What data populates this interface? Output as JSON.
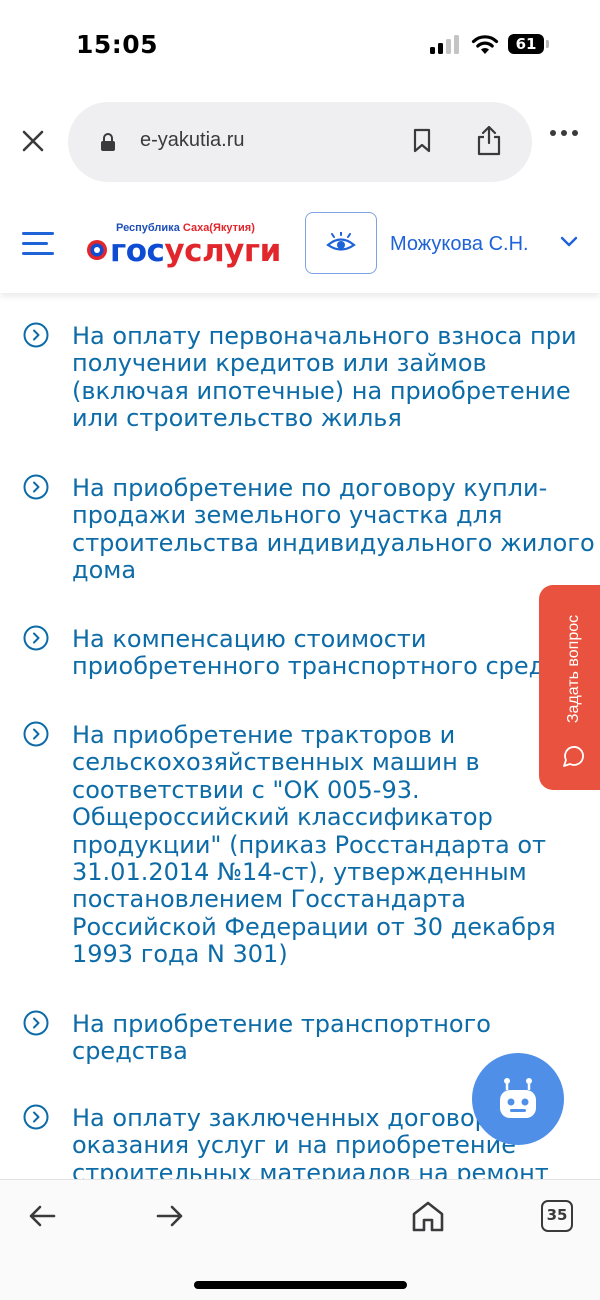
{
  "status_bar": {
    "time": "15:05",
    "battery": "61"
  },
  "browser": {
    "url": "e-yakutia.ru",
    "icons": [
      "close-icon",
      "lock-icon",
      "bookmark-icon",
      "share-icon",
      "more-icon"
    ]
  },
  "header": {
    "logo_region_prefix": "Республика ",
    "logo_region_suffix": "Саха(Якутия)",
    "logo_word_1": "гос",
    "logo_word_2": "услуги",
    "user_name": "Можукова С.Н.",
    "brand_blue": "#0d4cd3",
    "brand_red": "#e1262c"
  },
  "items": [
    {
      "text": "На оплату первоначального взноса при\nполучении кредитов или займов\n(включая ипотечные) на приобретение\nили строительство жилья"
    },
    {
      "text": "На приобретение по договору купли-\nпродажи земельного участка для\nстроительства индивидуального жилого\nдома"
    },
    {
      "text": "На компенсацию стоимости\nприобретенного транспортного средства"
    },
    {
      "text": "На приобретение тракторов и\nсельскохозяйственных машин в\nсоответствии с \"ОК 005-93.\nОбщероссийский классификатор\nпродукции\" (приказ Росстандарта от\n31.01.2014 №14-ст), утвержденным\nпостановлением Госстандарта\nРоссийской Федерации от 30 декабря\n1993 года N 301)"
    },
    {
      "text": "На приобретение транспортного\nсредства"
    },
    {
      "text": "На оплату заключенных договоров\nоказания услуг и на приобретение\nстроительных материалов на ремонт"
    }
  ],
  "side_tab": {
    "label": "Задать вопрос",
    "color": "#e9523e"
  },
  "bot": {
    "color": "#4f8fe8"
  },
  "toolbar": {
    "tabs_count": "35"
  },
  "link_color": "#0d6ca8"
}
